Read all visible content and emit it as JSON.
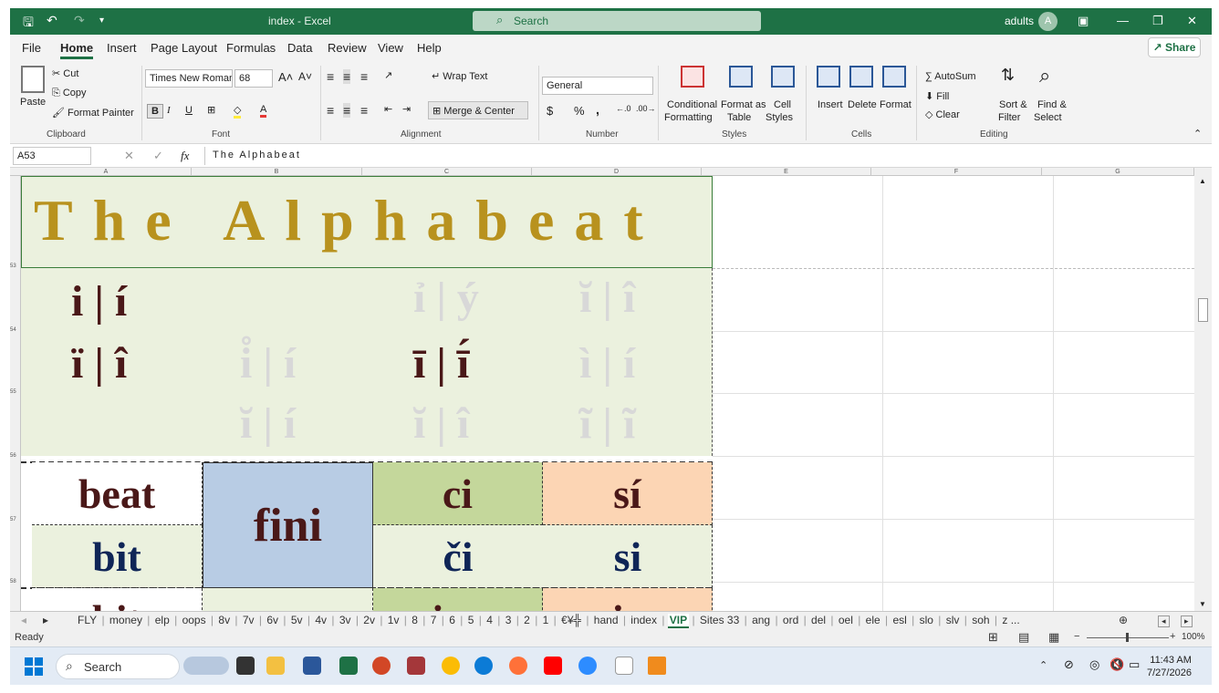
{
  "window": {
    "title": "index - Excel",
    "search_placeholder": "Search",
    "user": "adults",
    "avatar_letter": "A"
  },
  "menu": {
    "tabs": [
      "File",
      "Home",
      "Insert",
      "Page Layout",
      "Formulas",
      "Data",
      "Review",
      "View",
      "Help"
    ],
    "share": "Share"
  },
  "ribbon": {
    "clipboard": {
      "paste": "Paste",
      "cut": "Cut",
      "copy": "Copy",
      "format_painter": "Format Painter",
      "label": "Clipboard"
    },
    "font": {
      "name": "Times New Roman",
      "size": "68",
      "label": "Font",
      "bold": "B",
      "italic": "I",
      "underline": "U"
    },
    "alignment": {
      "wrap": "Wrap Text",
      "merge": "Merge & Center",
      "label": "Alignment"
    },
    "number": {
      "format": "General",
      "label": "Number",
      "currency": "$",
      "percent": "%",
      "comma": ","
    },
    "styles": {
      "conditional": "Conditional",
      "formatting": "Formatting",
      "format_as": "Format as",
      "table": "Table",
      "cell": "Cell",
      "cell_styles": "Styles",
      "label": "Styles"
    },
    "cells": {
      "insert": "Insert",
      "delete": "Delete",
      "format": "Format",
      "label": "Cells"
    },
    "editing": {
      "autosum": "AutoSum",
      "fill": "Fill",
      "clear": "Clear",
      "sort": "Sort &",
      "filter": "Filter",
      "find": "Find &",
      "select": "Select",
      "label": "Editing"
    }
  },
  "formula_bar": {
    "name_box": "A53",
    "fx": "fx",
    "content": "The Alphabeat"
  },
  "columns": [
    "A",
    "B",
    "C",
    "D",
    "E",
    "F",
    "G"
  ],
  "rows": [
    "53",
    "54",
    "55",
    "56",
    "57",
    "58"
  ],
  "sheet": {
    "title": "The Alphabeat",
    "row54": {
      "a": "i | í",
      "c_faint": "ỉ | ý",
      "d_faint": "ĭ | î"
    },
    "row55": {
      "a": "ï | î",
      "b_faint": "i̊ | í",
      "c": "ī | ī́",
      "d_faint": "ì | í"
    },
    "row56": {
      "b_faint": "ĭ | í",
      "c_faint": "ĭ | î",
      "d_faint": "ĩ | ĩ"
    },
    "words": {
      "beat": "beat",
      "fini": "fini",
      "ci": "ci",
      "si_acute": "sí",
      "bit": "bit",
      "chi": "či",
      "si": "si",
      "bit2": "bit",
      "ira": "ira",
      "ir": "ir"
    },
    "colors": {
      "beat_fill": "#ffffff",
      "fini_fill": "#b8cce4",
      "ci_fill": "#c4d79b",
      "si_fill": "#fcd5b4",
      "green": "#ebf1de",
      "title_text": "#b8921e",
      "dark_text": "#4a1818",
      "navy_text": "#0f2557"
    }
  },
  "tabs": [
    "FLY",
    "money",
    "elp",
    "oops",
    "8v",
    "7v",
    "6v",
    "5v",
    "4v",
    "3v",
    "2v",
    "1v",
    "8",
    "7",
    "6",
    "5",
    "4",
    "3",
    "2",
    "1",
    "€¥╬",
    "hand",
    "index",
    "VIP",
    "Sites 33",
    "ang",
    "ord",
    "del",
    "oel",
    "ele",
    "esl",
    "slo",
    "slv",
    "soh",
    "z ..."
  ],
  "active_tab": "VIP",
  "status": {
    "ready": "Ready",
    "zoom": "100%"
  },
  "taskbar": {
    "search": "Search",
    "time": "11:43 AM",
    "date": "7/27/2026"
  }
}
